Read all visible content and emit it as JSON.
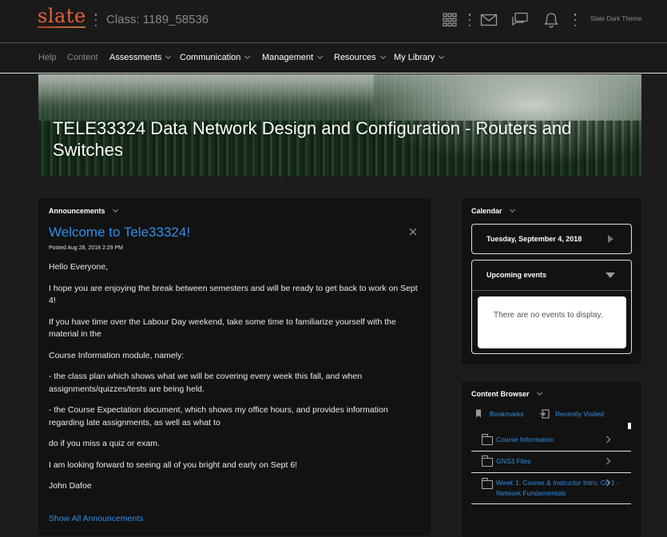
{
  "topbar": {
    "logo": "slate",
    "class_label": "Class: 1189_58536",
    "theme_label": "Slate Dark Theme",
    "icons": [
      "grid-icon",
      "mail-icon",
      "chat-icon",
      "bell-icon"
    ]
  },
  "nav": {
    "items": [
      {
        "label": "Help",
        "dropdown": false
      },
      {
        "label": "Content",
        "dropdown": false
      },
      {
        "label": "Assessments",
        "dropdown": true
      },
      {
        "label": "Communication",
        "dropdown": true
      },
      {
        "label": "Management",
        "dropdown": true
      },
      {
        "label": "Resources",
        "dropdown": true
      },
      {
        "label": "My Library",
        "dropdown": true
      }
    ]
  },
  "banner": {
    "course_title": "TELE33324 Data Network Design and Configuration - Routers and Switches"
  },
  "announcements": {
    "header": "Announcements",
    "title": "Welcome to Tele33324!",
    "posted": "Posted Aug 28, 2018 2:29 PM",
    "paragraphs": [
      "Hello Everyone,",
      "I hope you are enjoying the break between semesters and will be ready to get back to work on Sept 4!",
      "If you have time over the Labour Day weekend, take some time to familiarize yourself with the material in the",
      "Course Information module, namely:",
      "- the class plan which shows what we will be covering every week this fall, and when assignments/quizzes/tests are being held.",
      "- the Course Expectation document, which shows my office hours, and provides information regarding late assignments, as well as what to",
      "do if you miss a quiz or exam.",
      "I am looking forward to seeing all of you bright and early on Sept 6!",
      "John Dafoe"
    ],
    "show_all": "Show All Announcements"
  },
  "calendar": {
    "header": "Calendar",
    "date": "Tuesday, September 4, 2018",
    "upcoming_label": "Upcoming events",
    "no_events": "There are no events to display."
  },
  "content_browser": {
    "header": "Content Browser",
    "tabs": {
      "bookmarks": "Bookmarks",
      "recently_visited": "Recently Visited"
    },
    "items": [
      {
        "label": "Course Information"
      },
      {
        "label": "GNS3 Files"
      },
      {
        "label": "Week 1: Course & Instructor Intro; Ch 1 - Network Fundamentals"
      }
    ]
  },
  "colors": {
    "background": "#1c1c1c",
    "panel": "#121212",
    "link": "#2e8fe6",
    "logo": "#e8613a"
  }
}
